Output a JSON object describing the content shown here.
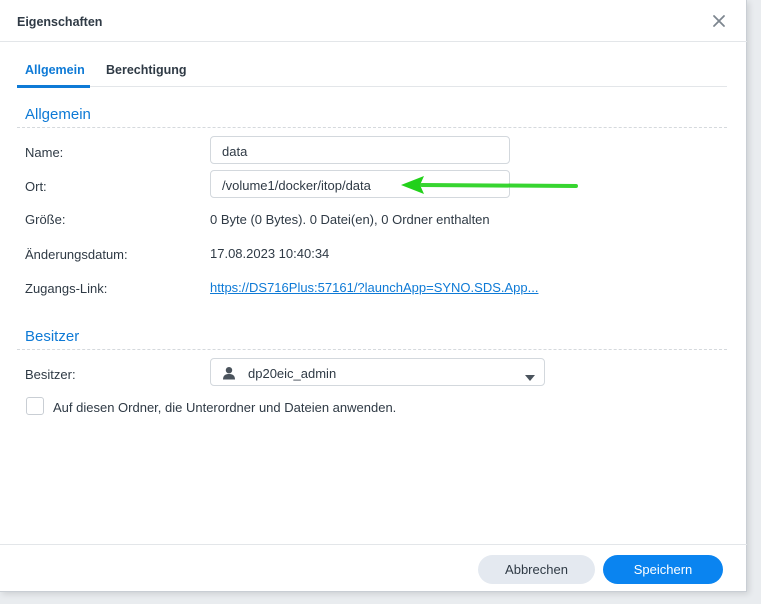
{
  "dialog": {
    "title": "Eigenschaften",
    "close_icon": "close-icon"
  },
  "tabs": [
    {
      "label": "Allgemein",
      "active": true
    },
    {
      "label": "Berechtigung",
      "active": false
    }
  ],
  "general": {
    "section_title": "Allgemein",
    "name_label": "Name:",
    "name_value": "data",
    "location_label": "Ort:",
    "location_value": "/volume1/docker/itop/data",
    "size_label": "Größe:",
    "size_value": "0 Byte (0 Bytes). 0 Datei(en), 0 Ordner enthalten",
    "modified_label": "Änderungsdatum:",
    "modified_value": "17.08.2023 10:40:34",
    "link_label": "Zugangs-Link:",
    "link_value": "https://DS716Plus:57161/?launchApp=SYNO.SDS.App..."
  },
  "owner": {
    "section_title": "Besitzer",
    "owner_label": "Besitzer:",
    "owner_value": "dp20eic_admin",
    "apply_label": "Auf diesen Ordner, die Unterordner und Dateien anwenden.",
    "apply_checked": false
  },
  "footer": {
    "cancel_label": "Abbrechen",
    "save_label": "Speichern"
  },
  "colors": {
    "accent": "#0e7ad6",
    "primary_button": "#0a84f0",
    "annotation_arrow": "#22d11a"
  }
}
